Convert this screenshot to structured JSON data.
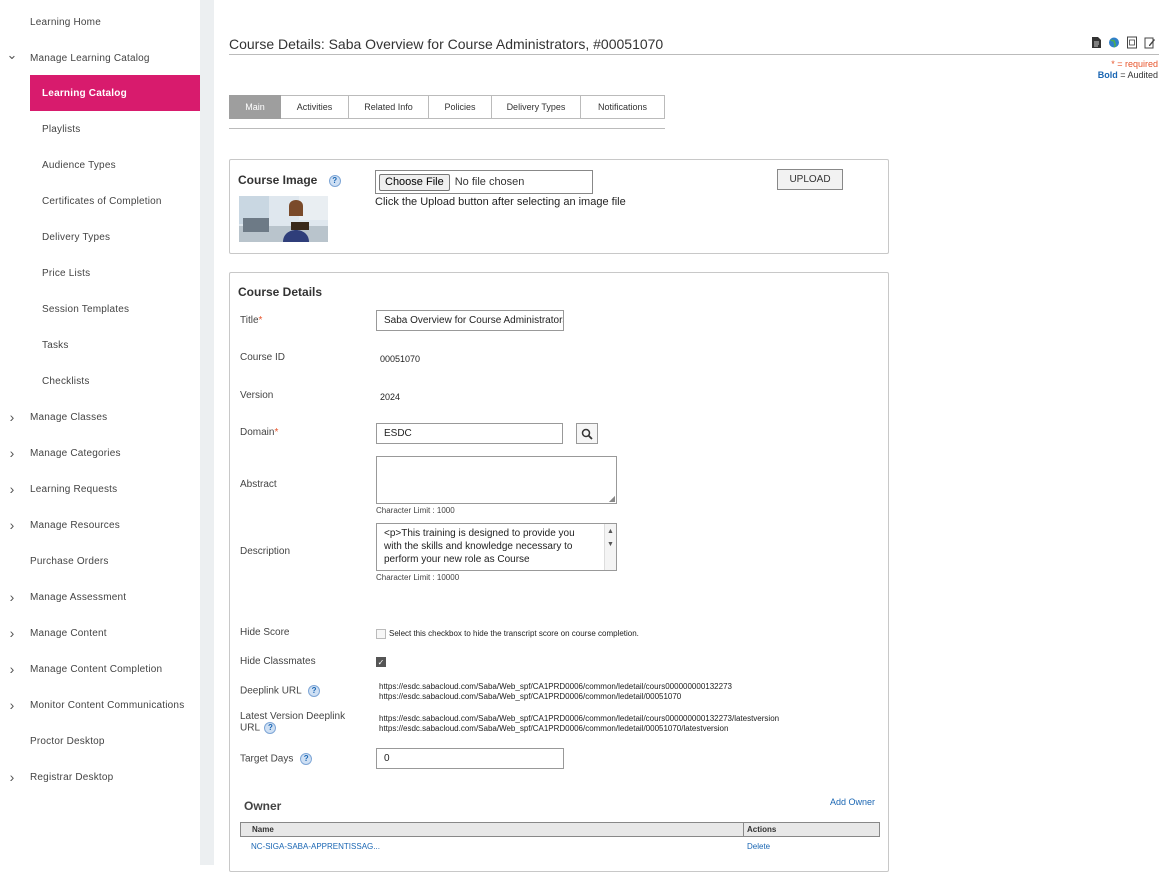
{
  "sidebar": {
    "items": [
      {
        "label": "Learning Home",
        "chevron": ""
      },
      {
        "label": "Manage Learning Catalog",
        "chevron": "chevron-down"
      },
      {
        "label": "Learning Catalog",
        "chevron": "",
        "active": true
      },
      {
        "label": "Playlists",
        "chevron": ""
      },
      {
        "label": "Audience Types",
        "chevron": ""
      },
      {
        "label": "Certificates of Completion",
        "chevron": ""
      },
      {
        "label": "Delivery Types",
        "chevron": ""
      },
      {
        "label": "Price Lists",
        "chevron": ""
      },
      {
        "label": "Session Templates",
        "chevron": ""
      },
      {
        "label": "Tasks",
        "chevron": ""
      },
      {
        "label": "Checklists",
        "chevron": ""
      },
      {
        "label": "Manage Classes",
        "chevron": "chevron-right"
      },
      {
        "label": "Manage Categories",
        "chevron": "chevron-right"
      },
      {
        "label": "Learning Requests",
        "chevron": "chevron-right"
      },
      {
        "label": "Manage Resources",
        "chevron": "chevron-right"
      },
      {
        "label": "Purchase Orders",
        "chevron": ""
      },
      {
        "label": "Manage Assessment",
        "chevron": "chevron-right"
      },
      {
        "label": "Manage Content",
        "chevron": "chevron-right"
      },
      {
        "label": "Manage Content Completion",
        "chevron": "chevron-right"
      },
      {
        "label": "Monitor Content Communications",
        "chevron": "chevron-right"
      },
      {
        "label": "Proctor Desktop",
        "chevron": ""
      },
      {
        "label": "Registrar Desktop",
        "chevron": "chevron-right"
      }
    ],
    "active_color": "#d81b6d"
  },
  "header": {
    "title": "Course Details: Saba Overview for Course Administrators, #00051070",
    "required_note": "* = required",
    "audited_bold": "Bold",
    "audited_rest": " = Audited",
    "tool_icons": [
      "document-icon",
      "globe-icon",
      "report-icon",
      "edit-icon"
    ]
  },
  "tabs": [
    "Main",
    "Activities",
    "Related Info",
    "Policies",
    "Delivery Types",
    "Notifications"
  ],
  "course_image": {
    "title": "Course Image",
    "choose_label": "Choose File",
    "no_file": "No file chosen",
    "hint": "Click the Upload button after selecting an image file",
    "upload_label": "UPLOAD"
  },
  "course_details": {
    "title": "Course Details",
    "title_label": "Title",
    "title_value": "Saba Overview for Course Administrators",
    "course_id_label": "Course ID",
    "course_id_value": "00051070",
    "version_label": "Version",
    "version_value": "2024",
    "domain_label": "Domain",
    "domain_value": "ESDC",
    "abstract_label": "Abstract",
    "abstract_limit": "Character Limit : 1000",
    "description_label": "Description",
    "description_value": "<p>This training is designed to provide you with the skills and knowledge necessary to perform your new role as Course Administrator",
    "description_limit": "Character Limit : 10000",
    "hide_score_label": "Hide Score",
    "hide_score_text": "Select this checkbox to hide the transcript score on course completion.",
    "hide_classmates_label": "Hide Classmates",
    "deeplink_label": "Deeplink URL",
    "deeplink_1": "https://esdc.sabacloud.com/Saba/Web_spf/CA1PRD0006/common/ledetail/cours000000000132273",
    "deeplink_2": "https://esdc.sabacloud.com/Saba/Web_spf/CA1PRD0006/common/ledetail/00051070",
    "latest_label_1": "Latest Version Deeplink",
    "latest_label_2": "URL",
    "latest_1": "https://esdc.sabacloud.com/Saba/Web_spf/CA1PRD0006/common/ledetail/cours000000000132273/latestversion",
    "latest_2": "https://esdc.sabacloud.com/Saba/Web_spf/CA1PRD0006/common/ledetail/00051070/latestversion",
    "target_days_label": "Target Days",
    "target_days_value": "0"
  },
  "owner": {
    "title": "Owner",
    "add_label": "Add Owner",
    "col_name": "Name",
    "col_actions": "Actions",
    "row_name": "NC-SIGA-SABA-APPRENTISSAG...",
    "row_action": "Delete"
  }
}
